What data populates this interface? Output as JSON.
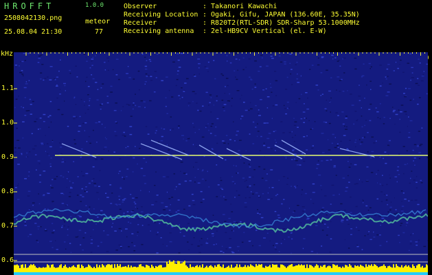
{
  "header": {
    "app_name": "HROFFT",
    "app_version": "1.0.0",
    "filename": "2508042130.png",
    "detection_type": "meteor",
    "datetime": "25.08.04 21:30",
    "count": "77"
  },
  "info": [
    {
      "key": "Observer",
      "value": ": Takanori Kawachi"
    },
    {
      "key": "Receiving Location",
      "value": ": Ogaki, Gifu, JAPAN (136.60E, 35.35N)"
    },
    {
      "key": "Receiver",
      "value": ": R820T2(RTL-SDR) SDR-Sharp 53.1000MHz"
    },
    {
      "key": "Receiving antenna",
      "value": ": 2el-HB9CV Vertical (el. E-W)"
    }
  ],
  "axis": {
    "unit": "kHz",
    "time_labels": [
      "2131",
      "2132",
      "2133",
      "2134",
      "2135",
      "2136",
      "2137",
      "2138",
      "2139",
      "2140"
    ],
    "freq_labels": [
      "1.1",
      "1.0",
      "0.9",
      "0.8",
      "0.7",
      "0.6"
    ]
  },
  "colors": {
    "background": "#000000",
    "spectrogram": "#141b80",
    "signal_line": "#e8ff70",
    "header_green": "#6ee86e",
    "header_yellow": "#ffff33",
    "grid_tick": "#ffff33",
    "bottom_bar": "#ffee00",
    "bottom_bar_base": "#22ccff"
  }
}
